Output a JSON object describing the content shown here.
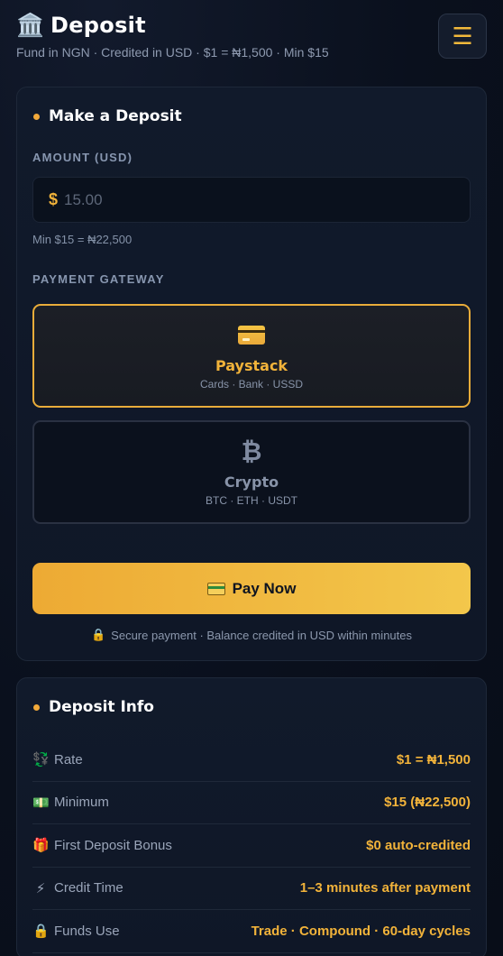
{
  "header": {
    "icon": "bank-icon",
    "title": "Deposit",
    "subtitle": "Fund in NGN · Credited in USD · $1 = ₦1,500 · Min $15",
    "menu_icon": "hamburger-menu-icon"
  },
  "deposit_card": {
    "title": "Make a Deposit",
    "amount_label": "AMOUNT (USD)",
    "currency_symbol": "$",
    "amount_placeholder": "15.00",
    "amount_value": "",
    "min_hint": "Min $15 = ₦22,500",
    "gateway_label": "PAYMENT GATEWAY",
    "gateways": [
      {
        "name": "Paystack",
        "sub": "Cards · Bank · USSD",
        "icon": "credit-card-icon",
        "selected": true
      },
      {
        "name": "Crypto",
        "sub": "BTC · ETH · USDT",
        "icon": "bitcoin-icon",
        "selected": false
      }
    ],
    "pay_button": "Pay Now",
    "secure_note": "Secure payment · Balance credited in USD within minutes"
  },
  "info_card": {
    "title": "Deposit Info",
    "rows": [
      {
        "icon": "currency-exchange-icon",
        "glyph": "💱",
        "label": "Rate",
        "value": "$1 = ₦1,500"
      },
      {
        "icon": "banknote-icon",
        "glyph": "💵",
        "label": "Minimum",
        "value": "$15 (₦22,500)"
      },
      {
        "icon": "gift-icon",
        "glyph": "🎁",
        "label": "First Deposit Bonus",
        "value": "$0 auto-credited"
      },
      {
        "icon": "lightning-icon",
        "glyph": "⚡",
        "label": "Credit Time",
        "value": "1–3 minutes after payment"
      },
      {
        "icon": "lock-icon",
        "glyph": "🔒",
        "label": "Funds Use",
        "value": "Trade · Compound · 60-day cycles"
      }
    ]
  },
  "colors": {
    "accent": "#f2b33a",
    "background": "#0b1120",
    "card": "#111a2b"
  }
}
